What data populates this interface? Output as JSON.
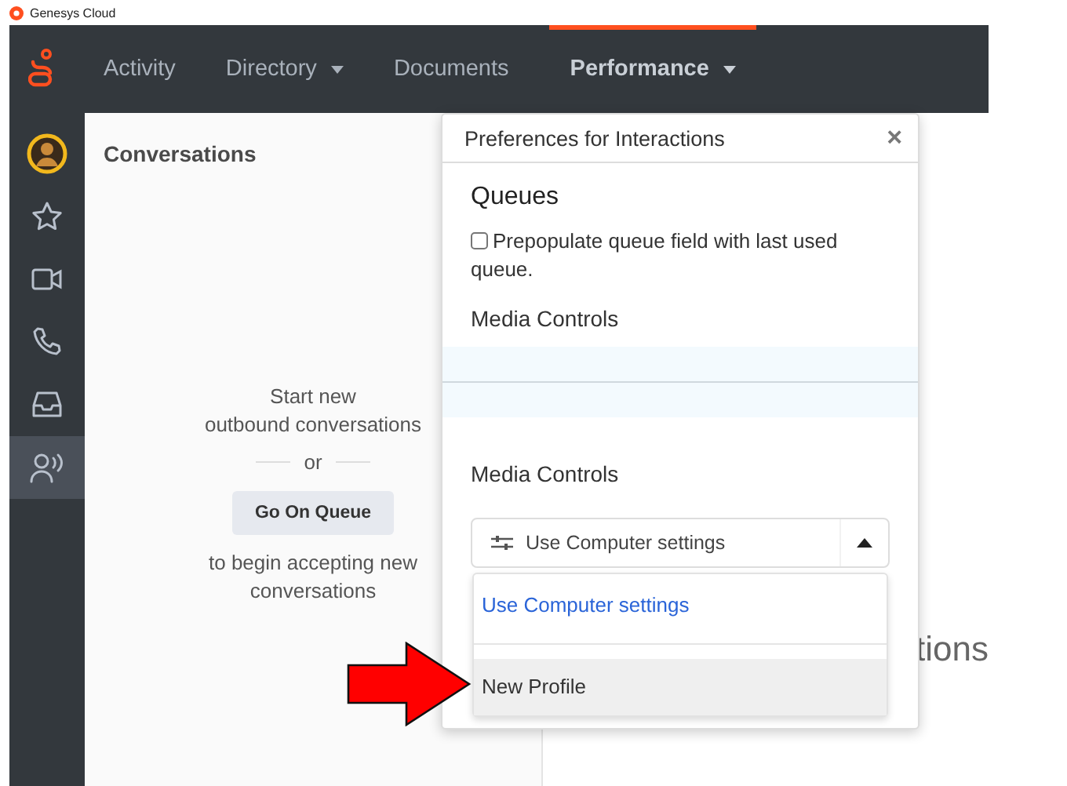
{
  "window": {
    "title": "Genesys Cloud"
  },
  "nav": {
    "items": [
      {
        "label": "Activity",
        "dropdown": false,
        "selected": false
      },
      {
        "label": "Directory",
        "dropdown": true,
        "selected": false
      },
      {
        "label": "Documents",
        "dropdown": false,
        "selected": false
      },
      {
        "label": "Performance",
        "dropdown": true,
        "selected": true
      }
    ]
  },
  "sidebar": {
    "items": [
      {
        "kind": "avatar",
        "selected": false
      },
      {
        "kind": "star",
        "selected": false
      },
      {
        "kind": "video",
        "selected": false
      },
      {
        "kind": "phone",
        "selected": false
      },
      {
        "kind": "inbox",
        "selected": false
      },
      {
        "kind": "speaker",
        "selected": true
      }
    ]
  },
  "conversations": {
    "title": "Conversations",
    "line_1": "Start new",
    "line_2": "outbound conversations",
    "separator": "or",
    "button": "Go On Queue",
    "footer": "to begin accepting new conversations"
  },
  "background_text": "tions",
  "dialog": {
    "title": "Preferences for Interactions",
    "close": "×",
    "queues_heading": "Queues",
    "checkbox": {
      "label": "Prepopulate queue field with last used queue.",
      "checked": false
    },
    "media_heading_1": "Media Controls",
    "media_heading_2": "Media Controls",
    "select": {
      "value": "Use Computer settings",
      "expanded": true,
      "options": [
        {
          "label": "Use Computer settings",
          "selected": true,
          "highlighted": false
        },
        {
          "label": "New Profile",
          "selected": false,
          "highlighted": true
        }
      ]
    }
  }
}
